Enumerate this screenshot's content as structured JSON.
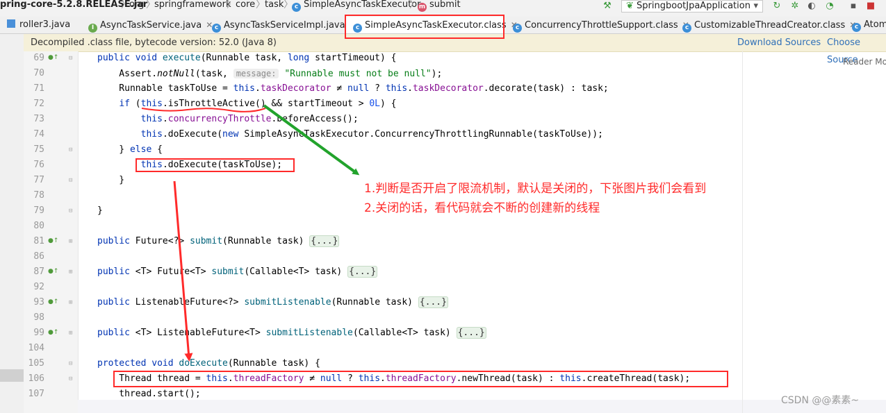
{
  "breadcrumb": {
    "items": [
      "pring-core-5.2.8.RELEASE.jar",
      "org",
      "springframework",
      "core",
      "task",
      "SimpleAsyncTaskExecutor",
      "submit"
    ]
  },
  "run_config": {
    "label": "SpringbootJpaApplication"
  },
  "tabs": [
    {
      "label": "roller3.java"
    },
    {
      "label": "AsyncTaskService.java"
    },
    {
      "label": "AsyncTaskServiceImpl.java"
    },
    {
      "label": "SimpleAsyncTaskExecutor.class"
    },
    {
      "label": "ConcurrencyThrottleSupport.class"
    },
    {
      "label": "CustomizableThreadCreator.class"
    },
    {
      "label": "Atom"
    }
  ],
  "infobar": {
    "message": "Decompiled .class file, bytecode version: 52.0 (Java 8)",
    "download_sources": "Download Sources",
    "choose_sources": "Choose Source"
  },
  "editor": {
    "reader_mode": "Reader Mo",
    "line_numbers": [
      "69",
      "70",
      "71",
      "72",
      "73",
      "74",
      "75",
      "76",
      "77",
      "78",
      "79",
      "80",
      "81",
      "86",
      "87",
      "92",
      "93",
      "98",
      "99",
      "104",
      "105",
      "106",
      "107"
    ],
    "lines": [
      {
        "tokens": [
          {
            "t": "public void ",
            "c": "kw"
          },
          {
            "t": "execute",
            "c": "fn"
          },
          {
            "t": "(Runnable task, ",
            "c": ""
          },
          {
            "t": "long",
            "c": "kw"
          },
          {
            "t": " startTimeout) {",
            "c": ""
          }
        ]
      },
      {
        "tokens": [
          {
            "t": "    Assert.",
            "c": ""
          },
          {
            "t": "notNull",
            "c": "ital"
          },
          {
            "t": "(task, ",
            "c": ""
          },
          {
            "t": "message:",
            "c": "hint"
          },
          {
            "t": " ",
            "c": ""
          },
          {
            "t": "\"Runnable must not be null\"",
            "c": "str"
          },
          {
            "t": ");",
            "c": ""
          }
        ]
      },
      {
        "tokens": [
          {
            "t": "    Runnable taskToUse = ",
            "c": ""
          },
          {
            "t": "this",
            "c": "kw"
          },
          {
            "t": ".",
            "c": ""
          },
          {
            "t": "taskDecorator",
            "c": "fld"
          },
          {
            "t": " ≠ ",
            "c": ""
          },
          {
            "t": "null",
            "c": "kw"
          },
          {
            "t": " ? ",
            "c": ""
          },
          {
            "t": "this",
            "c": "kw"
          },
          {
            "t": ".",
            "c": ""
          },
          {
            "t": "taskDecorator",
            "c": "fld"
          },
          {
            "t": ".decorate(task) : task;",
            "c": ""
          }
        ]
      },
      {
        "tokens": [
          {
            "t": "    ",
            "c": ""
          },
          {
            "t": "if",
            "c": "kw"
          },
          {
            "t": " (",
            "c": ""
          },
          {
            "t": "this",
            "c": "kw"
          },
          {
            "t": ".isThrottleActive() && startTimeout > ",
            "c": ""
          },
          {
            "t": "0L",
            "c": "num"
          },
          {
            "t": ") {",
            "c": ""
          }
        ]
      },
      {
        "tokens": [
          {
            "t": "        ",
            "c": ""
          },
          {
            "t": "this",
            "c": "kw"
          },
          {
            "t": ".",
            "c": ""
          },
          {
            "t": "concurrencyThrottle",
            "c": "fld"
          },
          {
            "t": ".beforeAccess();",
            "c": ""
          }
        ]
      },
      {
        "tokens": [
          {
            "t": "        ",
            "c": ""
          },
          {
            "t": "this",
            "c": "kw"
          },
          {
            "t": ".doExecute(",
            "c": ""
          },
          {
            "t": "new",
            "c": "kw"
          },
          {
            "t": " SimpleAsyncTaskExecutor.ConcurrencyThrottlingRunnable(taskToUse));",
            "c": ""
          }
        ]
      },
      {
        "tokens": [
          {
            "t": "    } ",
            "c": ""
          },
          {
            "t": "else",
            "c": "kw"
          },
          {
            "t": " {",
            "c": ""
          }
        ]
      },
      {
        "tokens": [
          {
            "t": "        ",
            "c": ""
          },
          {
            "t": "this",
            "c": "kw"
          },
          {
            "t": ".doExecute(taskToUse);",
            "c": ""
          }
        ]
      },
      {
        "tokens": [
          {
            "t": "    }",
            "c": ""
          }
        ]
      },
      {
        "tokens": []
      },
      {
        "tokens": [
          {
            "t": "}",
            "c": ""
          }
        ]
      },
      {
        "tokens": []
      },
      {
        "tokens": [
          {
            "t": "public",
            "c": "kw"
          },
          {
            "t": " Future<?> ",
            "c": ""
          },
          {
            "t": "submit",
            "c": "fn"
          },
          {
            "t": "(Runnable task) ",
            "c": ""
          },
          {
            "t": "{...}",
            "c": "foldbox"
          }
        ]
      },
      {
        "tokens": []
      },
      {
        "tokens": [
          {
            "t": "public",
            "c": "kw"
          },
          {
            "t": " <T> Future<T> ",
            "c": ""
          },
          {
            "t": "submit",
            "c": "fn"
          },
          {
            "t": "(Callable<T> task) ",
            "c": ""
          },
          {
            "t": "{...}",
            "c": "foldbox"
          }
        ]
      },
      {
        "tokens": []
      },
      {
        "tokens": [
          {
            "t": "public",
            "c": "kw"
          },
          {
            "t": " ListenableFuture<?> ",
            "c": ""
          },
          {
            "t": "submitListenable",
            "c": "fn"
          },
          {
            "t": "(Runnable task) ",
            "c": ""
          },
          {
            "t": "{...}",
            "c": "foldbox"
          }
        ]
      },
      {
        "tokens": []
      },
      {
        "tokens": [
          {
            "t": "public",
            "c": "kw"
          },
          {
            "t": " <T> ListenableFuture<T> ",
            "c": ""
          },
          {
            "t": "submitListenable",
            "c": "fn"
          },
          {
            "t": "(Callable<T> task) ",
            "c": ""
          },
          {
            "t": "{...}",
            "c": "foldbox"
          }
        ]
      },
      {
        "tokens": []
      },
      {
        "tokens": [
          {
            "t": "protected void ",
            "c": "kw"
          },
          {
            "t": "doExecute",
            "c": "fn"
          },
          {
            "t": "(Runnable task) {",
            "c": ""
          }
        ]
      },
      {
        "tokens": [
          {
            "t": "    Thread thread = ",
            "c": ""
          },
          {
            "t": "this",
            "c": "kw"
          },
          {
            "t": ".",
            "c": ""
          },
          {
            "t": "threadFactory",
            "c": "fld"
          },
          {
            "t": " ≠ ",
            "c": ""
          },
          {
            "t": "null",
            "c": "kw"
          },
          {
            "t": " ? ",
            "c": ""
          },
          {
            "t": "this",
            "c": "kw"
          },
          {
            "t": ".",
            "c": ""
          },
          {
            "t": "threadFactory",
            "c": "fld"
          },
          {
            "t": ".newThread(task) : ",
            "c": ""
          },
          {
            "t": "this",
            "c": "kw"
          },
          {
            "t": ".createThread(task);",
            "c": ""
          }
        ]
      },
      {
        "tokens": [
          {
            "t": "    thread.start();",
            "c": ""
          }
        ]
      }
    ]
  },
  "annotations": {
    "note1": "1.判断是否开启了限流机制，默认是关闭的，下张图片我们会看到",
    "note2": "2.关闭的话，看代码就会不断的创建新的线程"
  },
  "watermark": "CSDN @@素素~",
  "colors": {
    "annotation_red": "#ff2a2a",
    "arrow_green": "#22a32c",
    "link_blue": "#2f6fb8"
  }
}
